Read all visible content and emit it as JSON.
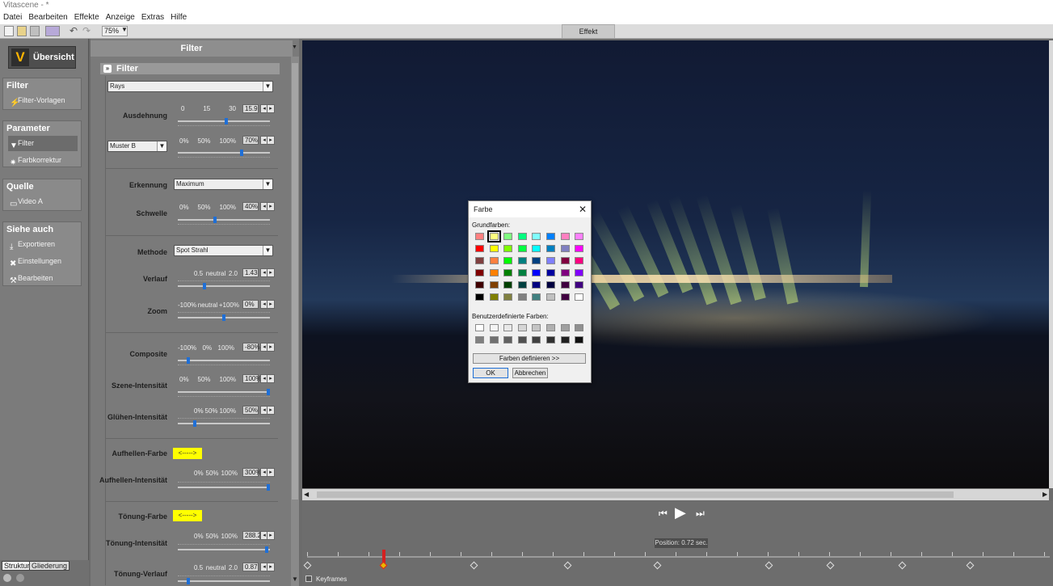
{
  "window": {
    "title": "Vitascene - *"
  },
  "menu": [
    "Datei",
    "Bearbeiten",
    "Effekte",
    "Anzeige",
    "Extras",
    "Hilfe"
  ],
  "toolbar": {
    "zoom": "75%",
    "effect_button": "Effekt aussetzen"
  },
  "nav": {
    "overview": "Übersicht",
    "logo_letter": "V",
    "groups": [
      {
        "title": "Filter",
        "items": [
          "Filter-Vorlagen"
        ]
      },
      {
        "title": "Parameter",
        "items": [
          "Filter",
          "Farbkorrektur"
        ]
      },
      {
        "title": "Quelle",
        "items": [
          "Video A"
        ]
      },
      {
        "title": "Siehe auch",
        "items": [
          "Exportieren",
          "Einstellungen",
          "Bearbeiten"
        ]
      }
    ],
    "tabs": [
      "Struktur",
      "Gliederung"
    ]
  },
  "panel": {
    "header": "Filter",
    "section": "Filter",
    "filter_select": "Rays",
    "muster_select": "Muster B",
    "erkennung_select": "Maximum",
    "methode_select": "Spot Strahl",
    "params": {
      "ausdehnung": {
        "label": "Ausdehnung",
        "ticks": [
          "0",
          "15",
          "30"
        ],
        "value": "15.9",
        "level": 0.53
      },
      "muster": {
        "ticks": [
          "0%",
          "50%",
          "100%"
        ],
        "value": "70%",
        "level": 0.7
      },
      "erkennung": {
        "label": "Erkennung"
      },
      "schwelle": {
        "label": "Schwelle",
        "ticks": [
          "0%",
          "50%",
          "100%"
        ],
        "value": "40%",
        "level": 0.4
      },
      "methode": {
        "label": "Methode"
      },
      "verlauf": {
        "label": "Verlauf",
        "ticks": [
          "0.5",
          "neutral",
          "2.0"
        ],
        "value": "1.43",
        "level": 0.28
      },
      "zoom": {
        "label": "Zoom",
        "ticks": [
          "-100%",
          "neutral",
          "+100%"
        ],
        "value": "0%",
        "level": 0.5
      },
      "composite": {
        "label": "Composite",
        "ticks": [
          "-100%",
          "0%",
          "100%"
        ],
        "value": "-80%",
        "level": 0.1
      },
      "szene": {
        "label": "Szene-Intensität",
        "ticks": [
          "0%",
          "50%",
          "100%"
        ],
        "value": "100%",
        "level": 1.0
      },
      "gluehen": {
        "label": "Glühen-Intensität",
        "ticks": [
          "0%",
          "50%",
          "100%"
        ],
        "value": "50%",
        "level": 0.17
      },
      "aufhellen_farbe": {
        "label": "Aufhellen-Farbe",
        "button": "<----->"
      },
      "aufhellen": {
        "label": "Aufhellen-Intensität",
        "ticks": [
          "0%",
          "50%",
          "100%"
        ],
        "value": "300%",
        "level": 1.0
      },
      "toenung_farbe": {
        "label": "Tönung-Farbe",
        "button": "<----->"
      },
      "toenung": {
        "label": "Tönung-Intensität",
        "ticks": [
          "0%",
          "50%",
          "100%"
        ],
        "value": "288.2%",
        "level": 0.98
      },
      "toenung_verlauf": {
        "label": "Tönung-Verlauf",
        "ticks": [
          "0.5",
          "neutral",
          "2.0"
        ],
        "value": "0.87",
        "level": 0.1
      }
    }
  },
  "preview": {
    "position_text": "Position: 0.72 sec."
  },
  "timeline": {
    "keyframes_label": "Keyframes"
  },
  "dialog": {
    "title": "Farbe",
    "basic_label": "Grundfarben:",
    "custom_label": "Benutzerdefinierte Farben:",
    "define_button": "Farben definieren >>",
    "ok_button": "OK",
    "cancel_button": "Abbrechen",
    "basic_colors": [
      [
        "#ff8080",
        "#ffff80",
        "#80ff80",
        "#00ff80",
        "#80ffff",
        "#0080ff",
        "#ff80c0",
        "#ff80ff"
      ],
      [
        "#ff0000",
        "#ffff00",
        "#80ff00",
        "#00ff40",
        "#00ffff",
        "#0080c0",
        "#8080c0",
        "#ff00ff"
      ],
      [
        "#804040",
        "#ff8040",
        "#00ff00",
        "#008080",
        "#004080",
        "#8080ff",
        "#800040",
        "#ff0080"
      ],
      [
        "#800000",
        "#ff8000",
        "#008000",
        "#008040",
        "#0000ff",
        "#0000a0",
        "#800080",
        "#8000ff"
      ],
      [
        "#400000",
        "#804000",
        "#004000",
        "#004040",
        "#000080",
        "#000040",
        "#400040",
        "#400080"
      ],
      [
        "#000000",
        "#808000",
        "#808040",
        "#808080",
        "#408080",
        "#c0c0c0",
        "#400040",
        "#ffffff"
      ]
    ],
    "custom_colors": [
      [
        "#ffffff",
        "#f4f4f4",
        "#e8e8e8",
        "#d6d6d6",
        "#c4c4c4",
        "#b0b0b0",
        "#a0a0a0",
        "#909090"
      ],
      [
        "#808080",
        "#707070",
        "#606060",
        "#505050",
        "#404040",
        "#303030",
        "#202020",
        "#101010"
      ]
    ],
    "selected": [
      0,
      1
    ]
  }
}
